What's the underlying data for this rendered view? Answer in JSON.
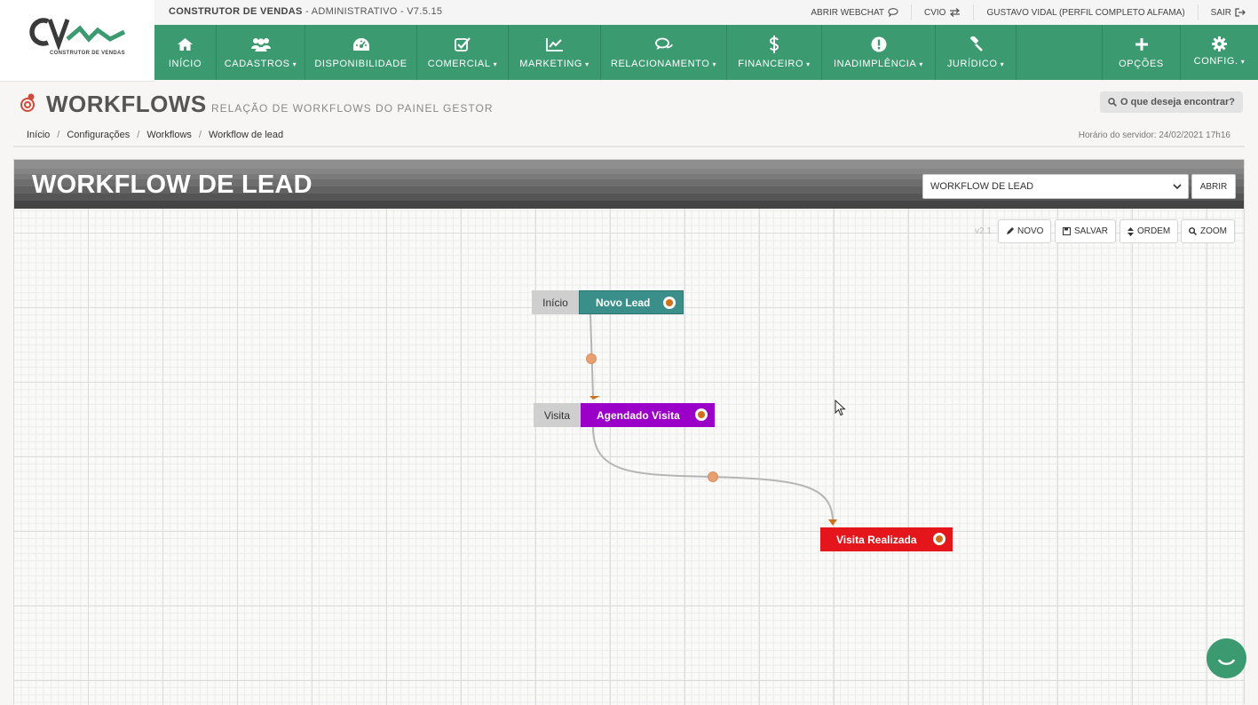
{
  "topbar": {
    "brand": "CONSTRUTOR DE VENDAS",
    "brand_rest": "- ADMINISTRATIVO - V7.5.15",
    "links": [
      "ABRIR WEBCHAT",
      "CVIO",
      "GUSTAVO VIDAL (PERFIL COMPLETO ALFAMA)",
      "SAIR"
    ]
  },
  "logo": {
    "text": "CV",
    "subtitle": "CONSTRUTOR DE VENDAS"
  },
  "nav": {
    "items": [
      {
        "label": "INÍCIO",
        "icon": "home-icon",
        "caret": false
      },
      {
        "label": "CADASTROS",
        "icon": "users-icon",
        "caret": true
      },
      {
        "label": "DISPONIBILIDADE",
        "icon": "dashboard-icon",
        "caret": false
      },
      {
        "label": "COMERCIAL",
        "icon": "checkbox-icon",
        "caret": true
      },
      {
        "label": "MARKETING",
        "icon": "chart-line-icon",
        "caret": true
      },
      {
        "label": "RELACIONAMENTO",
        "icon": "chat-icon",
        "caret": true
      },
      {
        "label": "FINANCEIRO",
        "icon": "dollar-icon",
        "caret": true
      },
      {
        "label": "INADIMPLÊNCIA",
        "icon": "alert-icon",
        "caret": true
      },
      {
        "label": "JURÍDICO",
        "icon": "gavel-icon",
        "caret": true
      }
    ],
    "right": [
      {
        "label": "OPÇÕES",
        "icon": "plus-icon"
      },
      {
        "label": "CONFIG.",
        "icon": "gear-icon"
      }
    ]
  },
  "page": {
    "title": "WORKFLOWS",
    "subtitle": "RELAÇÃO DE WORKFLOWS DO PAINEL GESTOR",
    "search_label": "O que deseja encontrar?",
    "breadcrumb": [
      "Início",
      "Configurações",
      "Workflows",
      "Workflow de lead"
    ],
    "server_time": "Horário do servidor: 24/02/2021 17h16"
  },
  "workflow": {
    "title": "WORKFLOW DE LEAD",
    "selected": "WORKFLOW DE LEAD",
    "open_button": "ABRIR",
    "version": "v2.1",
    "tools": [
      "NOVO",
      "SALVAR",
      "ORDEM",
      "ZOOM"
    ],
    "nodes": [
      {
        "label": "Início",
        "name": "Novo Lead",
        "color": "#3a8f8a"
      },
      {
        "label": "Visita",
        "name": "Agendado Visita",
        "color": "#9b00c9"
      },
      {
        "label": "",
        "name": "Visita Realizada",
        "color": "#e4161c"
      }
    ]
  },
  "colors": {
    "nav_green": "#3c9a70",
    "accent_orange": "#d0701b"
  }
}
